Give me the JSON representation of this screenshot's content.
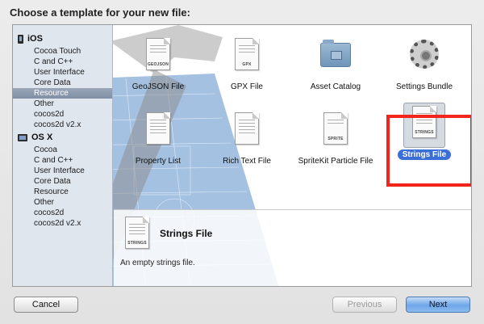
{
  "dialog": {
    "prompt": "Choose a template for your new file:"
  },
  "sidebar": {
    "sections": [
      {
        "title": "iOS",
        "icon": "iphone-icon",
        "items": [
          "Cocoa Touch",
          "C and C++",
          "User Interface",
          "Core Data",
          "Resource",
          "Other",
          "cocos2d",
          "cocos2d v2.x"
        ]
      },
      {
        "title": "OS X",
        "icon": "mac-icon",
        "items": [
          "Cocoa",
          "C and C++",
          "User Interface",
          "Core Data",
          "Resource",
          "Other",
          "cocos2d",
          "cocos2d v2.x"
        ]
      }
    ],
    "selected": "iOS / Resource"
  },
  "templates": [
    {
      "label": "GeoJSON File",
      "icon": "geojson-file-icon",
      "tag": "GEOJSON"
    },
    {
      "label": "GPX File",
      "icon": "gpx-file-icon",
      "tag": "GPX"
    },
    {
      "label": "Asset Catalog",
      "icon": "folder-icon",
      "tag": ""
    },
    {
      "label": "Settings Bundle",
      "icon": "gear-icon",
      "tag": ""
    },
    {
      "label": "Property List",
      "icon": "plist-file-icon",
      "tag": ""
    },
    {
      "label": "Rich Text File",
      "icon": "rtf-file-icon",
      "tag": ""
    },
    {
      "label": "SpriteKit Particle File",
      "icon": "sprite-file-icon",
      "tag": "SPRITE"
    },
    {
      "label": "Strings File",
      "icon": "strings-file-icon",
      "tag": "STRINGS",
      "selected": true
    }
  ],
  "detail": {
    "title": "Strings File",
    "description": "An empty strings file.",
    "icon_tag": "STRINGS"
  },
  "buttons": {
    "cancel": "Cancel",
    "previous": "Previous",
    "next": "Next"
  },
  "colors": {
    "highlight": "#f2241b",
    "selection": "#3a6fd8",
    "sidebar_selection": "#8594a8"
  }
}
